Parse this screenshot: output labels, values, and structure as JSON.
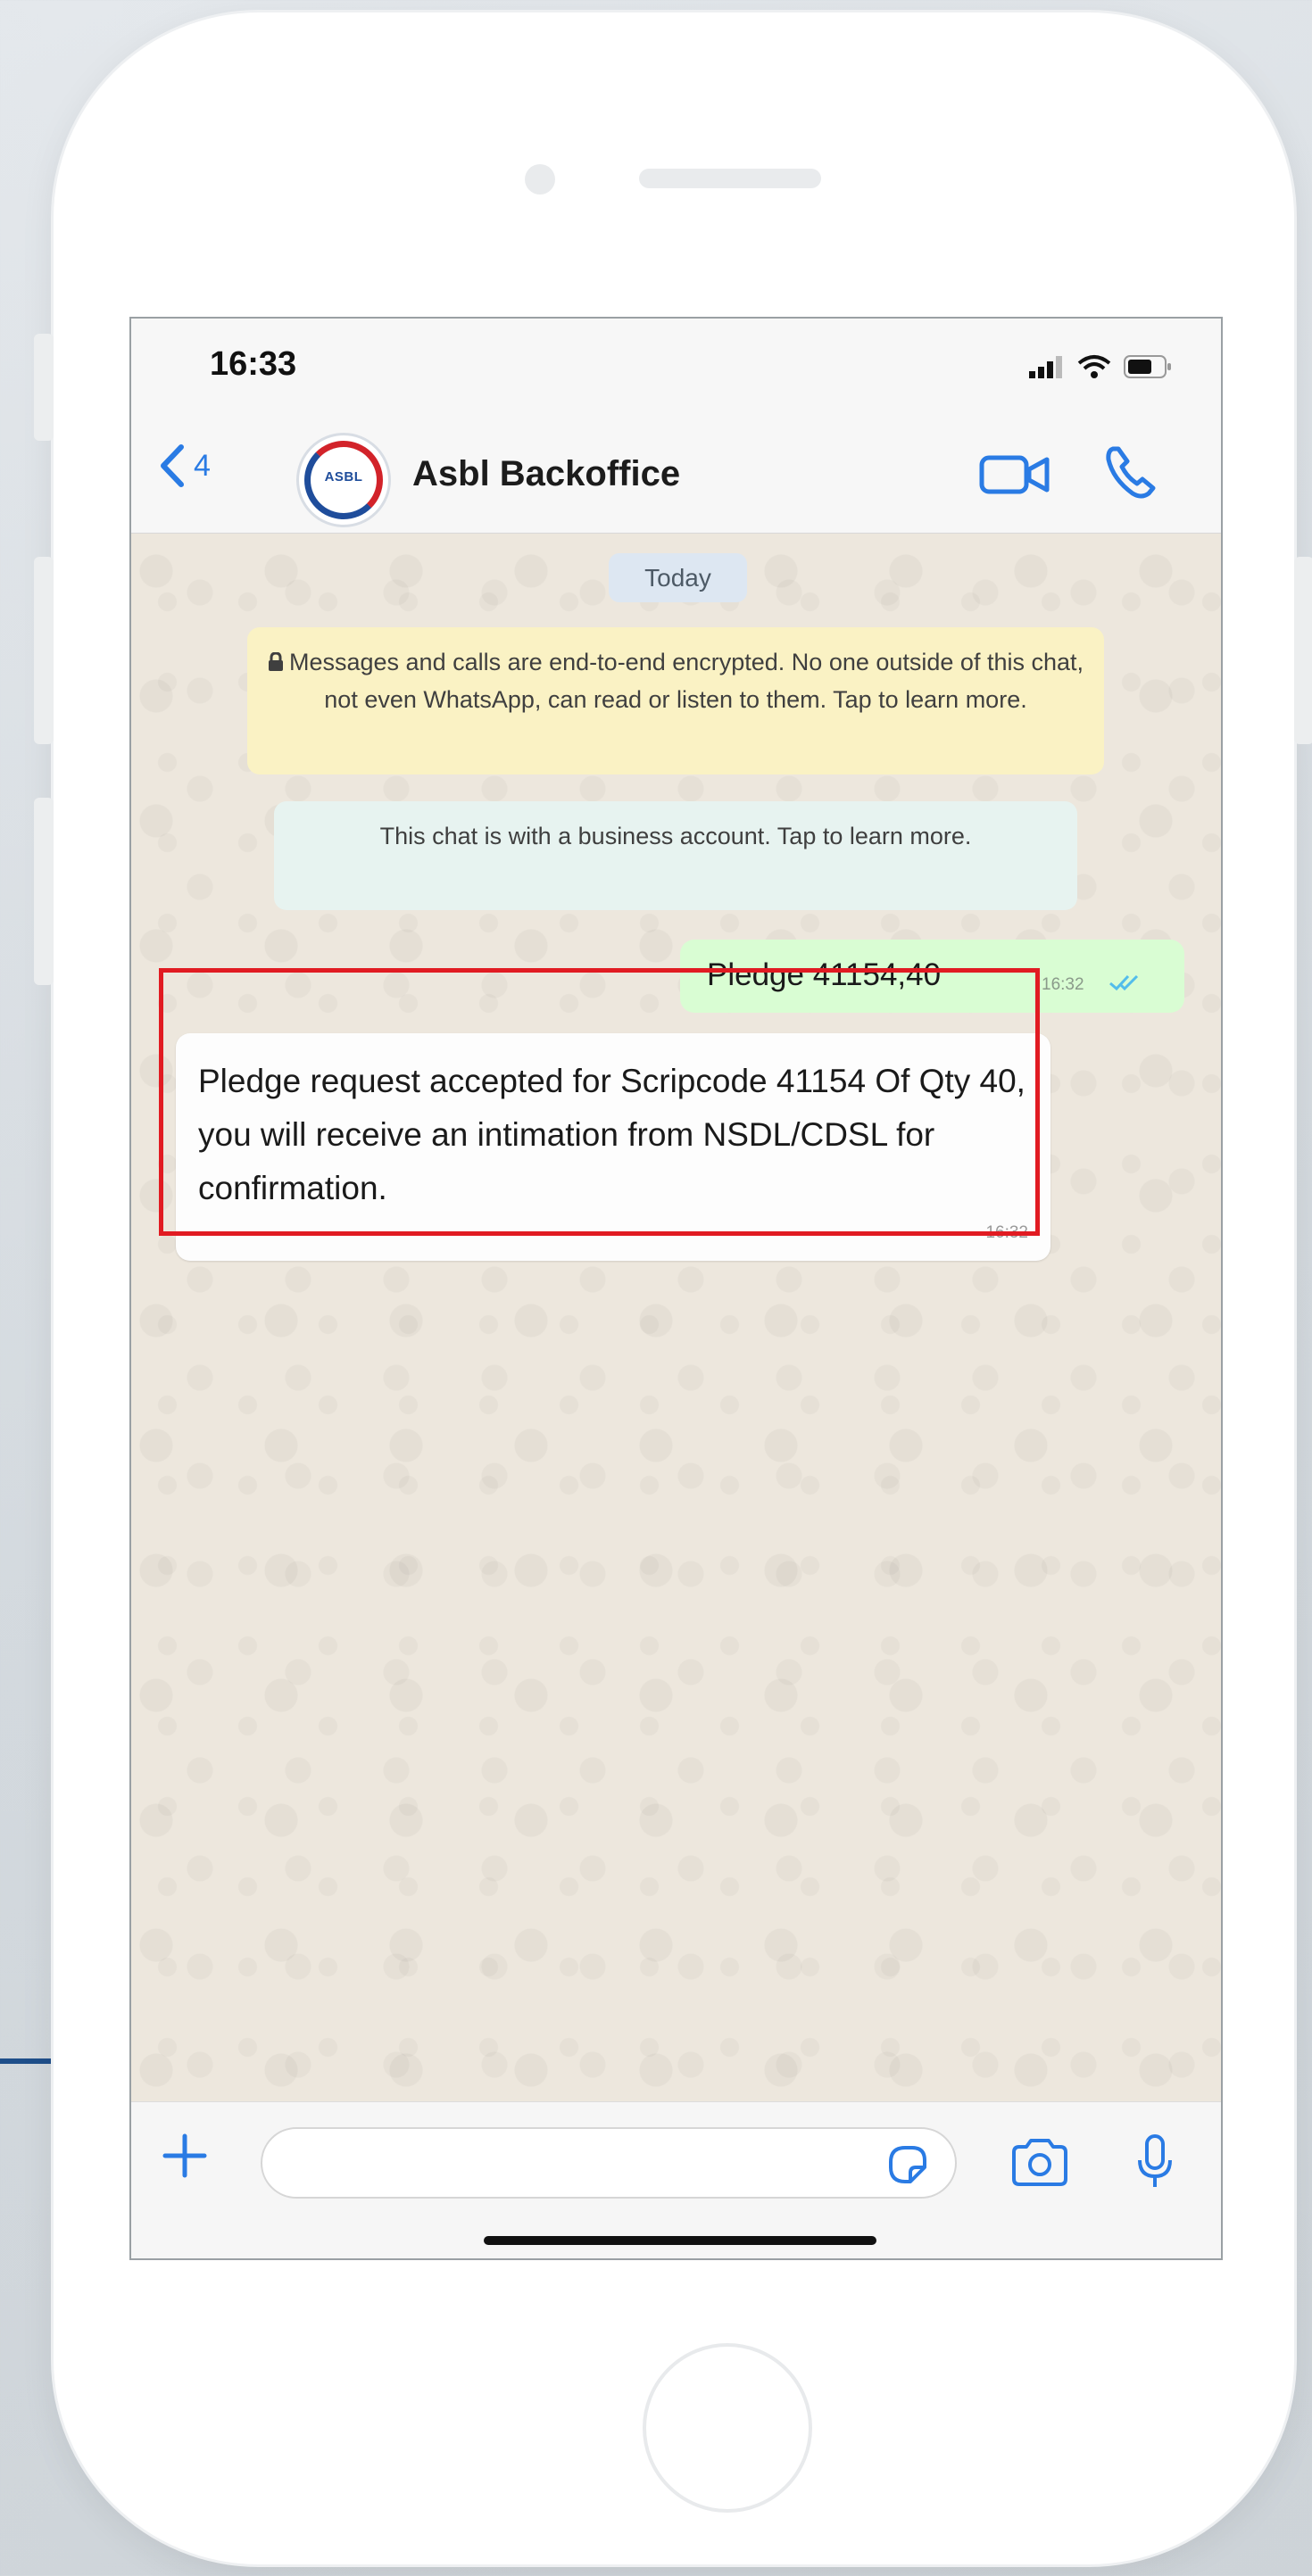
{
  "status_bar": {
    "time": "16:33"
  },
  "header": {
    "back_count": "4",
    "avatar_logo_text": "ASBL",
    "contact_name": "Asbl Backoffice"
  },
  "chat": {
    "date_label": "Today",
    "encryption_notice": "Messages and calls are end-to-end encrypted. No one outside of this chat, not even WhatsApp, can read or listen to them. Tap to learn more.",
    "business_notice": "This chat is with a business account. Tap to learn more.",
    "outgoing_message": {
      "text": "Pledge 41154,40",
      "time": "16:32"
    },
    "incoming_message": {
      "text": "Pledge request accepted for Scripcode 41154 Of Qty 40, you will receive an intimation from NSDL/CDSL for confirmation.",
      "time": "16:32"
    }
  },
  "composer": {
    "placeholder": ""
  },
  "colors": {
    "accent_blue": "#2a7be4",
    "highlight_red": "#e11b22",
    "connector_blue": "#1f4f8a",
    "outgoing_bubble": "#d9fdd3",
    "encryption_bubble": "#faf2c4"
  },
  "icons": [
    "lock-icon",
    "back-chevron-icon",
    "video-call-icon",
    "voice-call-icon",
    "plus-icon",
    "sticker-icon",
    "camera-icon",
    "mic-icon",
    "signal-icon",
    "wifi-icon",
    "battery-icon",
    "read-ticks-icon"
  ]
}
